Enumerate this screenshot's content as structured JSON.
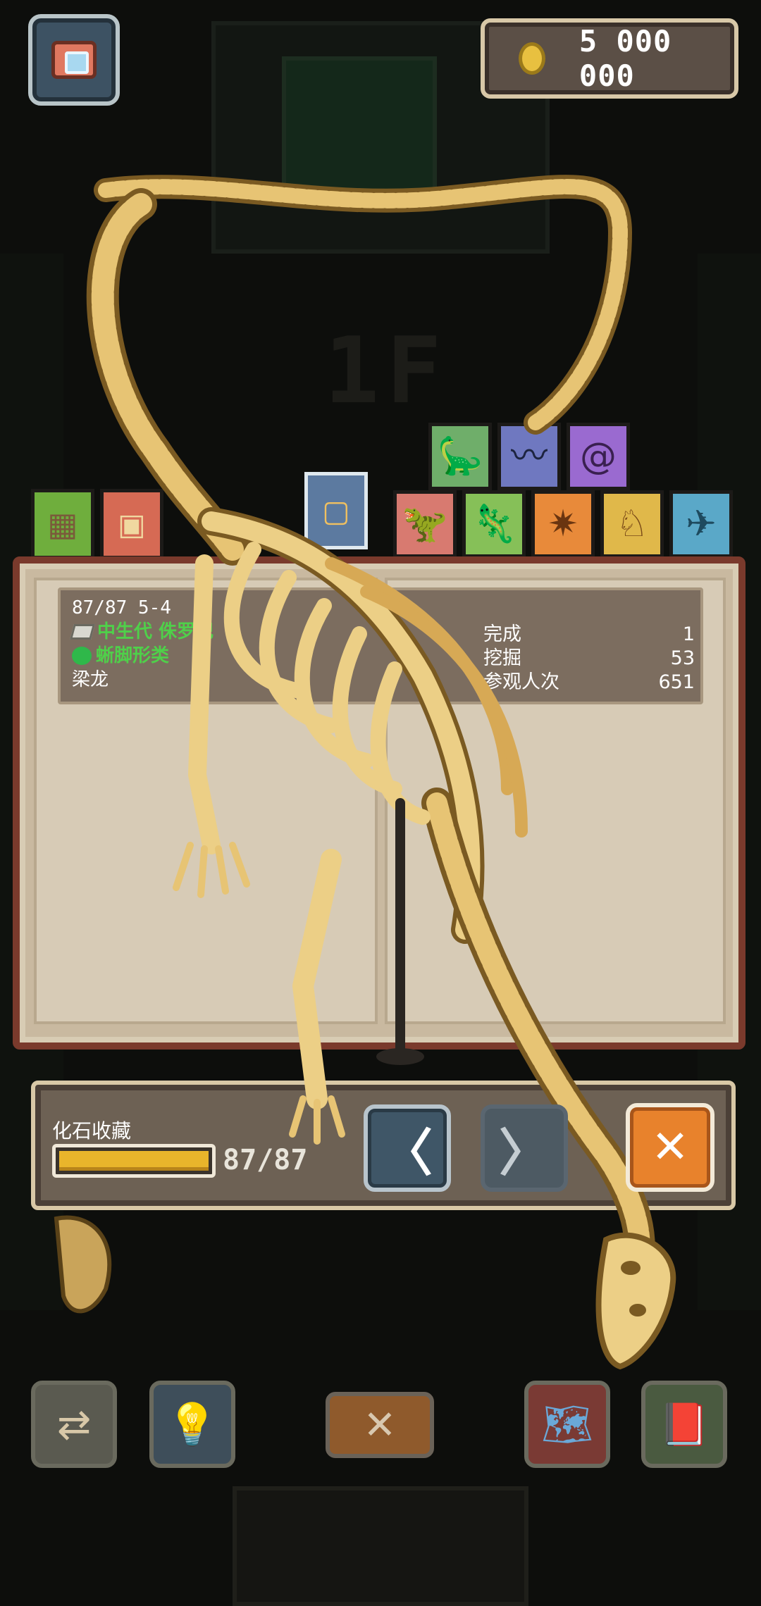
{
  "header": {
    "camera_icon": "camera-icon",
    "coins": "5 000 000",
    "coin_icon": "coin-icon"
  },
  "background": {
    "floor_label": "1F"
  },
  "category_tabs": {
    "left": [
      {
        "icon": "crate-icon",
        "color": "#6fae3d"
      },
      {
        "icon": "chest-icon",
        "color": "#d66a54"
      },
      {
        "icon": "frame-icon",
        "color": "#5c7aa0"
      }
    ],
    "top_row": [
      {
        "icon": "sauropod-icon",
        "color": "#6fae6a"
      },
      {
        "icon": "plesiosaur-icon",
        "color": "#6f78c0"
      },
      {
        "icon": "ammonite-icon",
        "color": "#9a6ad0"
      }
    ],
    "bottom_row": [
      {
        "icon": "theropod-icon",
        "color": "#d87a70"
      },
      {
        "icon": "ornithopod-icon",
        "color": "#86c058"
      },
      {
        "icon": "stegosaur-icon",
        "color": "#e88a3a"
      },
      {
        "icon": "ceratopsian-icon",
        "color": "#e0b84a"
      },
      {
        "icon": "pterosaur-icon",
        "color": "#5aa8c8"
      }
    ]
  },
  "info": {
    "index": "87/87  5-4",
    "era": "中生代  侏罗纪",
    "group": "蜥脚形类",
    "name": "梁龙",
    "stats": [
      {
        "label": "完成",
        "value": "1"
      },
      {
        "label": "挖掘",
        "value": "53"
      },
      {
        "label": "参观人次",
        "value": "651"
      }
    ]
  },
  "collection": {
    "label": "化石收藏",
    "progress_text": "87/87",
    "progress_fraction": 1.0
  },
  "controls": {
    "prev_label": "〈",
    "next_label": "〉",
    "close_label": "✕"
  },
  "toolbar": {
    "items": [
      {
        "icon": "swap-icon"
      },
      {
        "icon": "lightbulb-icon"
      },
      {
        "icon": "close-icon",
        "label": "✕"
      },
      {
        "icon": "map-icon"
      },
      {
        "icon": "journal-icon"
      }
    ]
  },
  "colors": {
    "accent_green": "#4fd04a",
    "progress_fill": "#e9b52b",
    "close_orange": "#e8822c",
    "bone": "#e7c474"
  }
}
